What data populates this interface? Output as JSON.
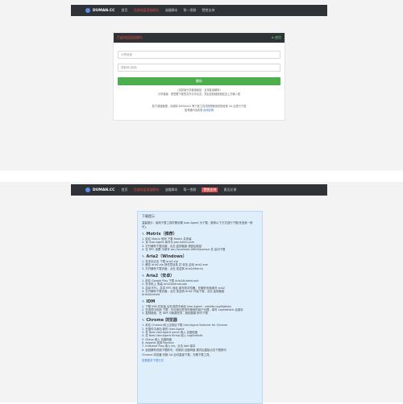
{
  "top": {
    "nav": {
      "logo": "DUMAN.CC",
      "items": [
        "首页",
        "百度网盘直链解析",
        "油猴脚本",
        "帮一把群",
        "赞赏支持"
      ]
    },
    "panel": {
      "title": "百度网盘直链解析",
      "help": "⊕ 使用",
      "url_placeholder": "分享链接",
      "pwd_placeholder": "提取码(选填)",
      "submit": "解析",
      "note_lines": [
        "(请复制分享链接粘贴 · 支持批量解析)",
        "分享链接：把您要下载的文件分享出去，然后复制链接粘贴至上方输入框"
      ],
      "tip_lines": [
        "若下载速度慢，请使用 IDM/Aria2 等下载工具并按照使用说明设置 UA 后进行下载",
        "如有疑问请查看"
      ],
      "tip_link": "使用说明"
    }
  },
  "bottom": {
    "nav": {
      "logo": "DUMAN.CC",
      "items": [
        "首页",
        "百度网盘直链解析",
        "油猴脚本",
        "帮一把群",
        "赞赏支持",
        "意见反馈"
      ]
    },
    "guide": {
      "title": "下载提示",
      "intro": "温馨提示：使用下载工具时需设置 User-Agent 为下载，推荐以下方式进行下载(任选其一即可)。",
      "sections": [
        {
          "title": "Motrix（推荐）",
          "items": [
            "1. 前往 Motrix 官网 下载 Motrix 并安装",
            "2. 将 User-Agent 填写为 pan.baidu.com",
            "3. 打开解析下载页面，点击 复制链接 按钮后粘贴",
            "4. 在 RPC 设置 中填写 ws://localhost:16800/jsonrpc 并 启动下载"
          ]
        },
        {
          "title": "Aria2（Windows）",
          "items": [
            "1. 在本站点击 下载 aria2.zip",
            "2. 解压 aria2.zip 到任意目录 并 双击 启动 aria2.exe",
            "3. 打开解析下载页面，点击 发送到 Aria2(Motrix)"
          ]
        },
        {
          "title": "Aria2（安卓）",
          "items": [
            "1. 前往 Google Play 下载 Aria2Android.apk",
            "2. 在手机上 安装 Aria2Android.apk",
            "3. 启动 RPC，并将 RPC 地址 填写到浏览器，在解析页面填写 aria2",
            "4. 打开解析下载页面，点击 发送到 Aria2 开始下载，点击 复制链接",
            "   Aria2Android"
          ]
        },
        {
          "title": "IDM",
          "items": [
            "1. 下载 IDM 并安装 后在选项中添加 User-Agent：netdisk;LogStatistic",
            "2. 在选项中找到 下载 - 手动添加任务时使用的用户代理，填写 LogStatistic 后保存",
            "3. 复制链接，在 IDM 中新建任务，粘贴链接 即可下载"
          ]
        },
        {
          "title": "Chrome 浏览器",
          "items": [
            "1. 前往 Chrome 网上应用店下载 User-Agent Switcher for Chrome",
            "2. 在插件中添加 新的 User-Agent",
            "3. 在 New User-Agent name 填入 百度网盘",
            "4. 在 New User-Agent String 填入 LogStatistic",
            "5. Group 填入 百度网盘",
            "6. Append 选择 Replace",
            "7. Indicator Flag 填入 bd，点击 Add 保存",
            "8. 返回解析页面下载即可，切换到 百度网盘 模式后直接点击下载即可"
          ]
        }
      ],
      "footer_note": "Chrome 浏览器 切换 UA 后可直接下载，无需下载工具。",
      "footer_link": "查看更多下载方式"
    }
  }
}
